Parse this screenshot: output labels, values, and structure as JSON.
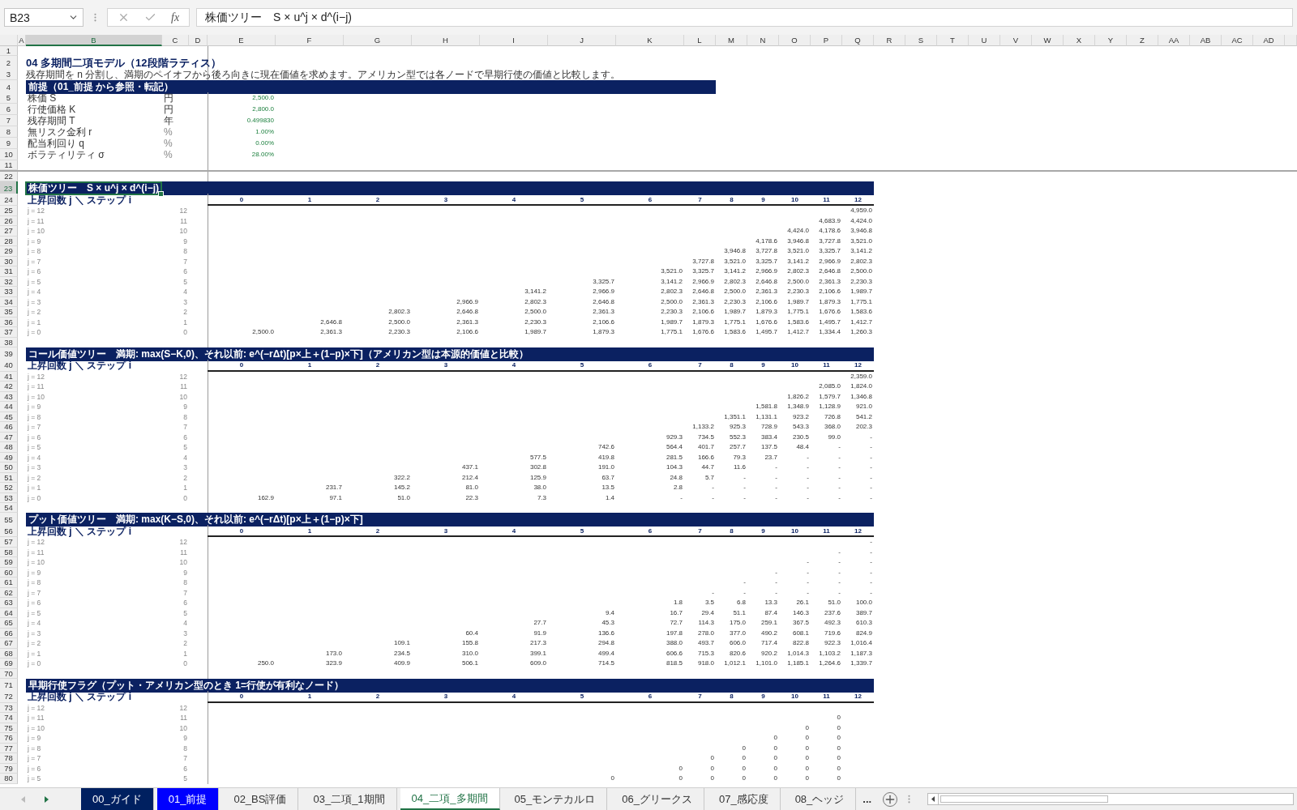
{
  "name_box": "B23",
  "function_label": "fx",
  "formula": "株価ツリー　S × u^j × d^(i−j)",
  "columns": [
    {
      "label": "A",
      "selected": false
    },
    {
      "label": "B",
      "selected": true
    },
    {
      "label": "C",
      "selected": false
    },
    {
      "label": "D",
      "selected": false
    },
    {
      "label": "E",
      "selected": false
    },
    {
      "label": "F",
      "selected": false
    },
    {
      "label": "G",
      "selected": false
    },
    {
      "label": "H",
      "selected": false
    },
    {
      "label": "I",
      "selected": false
    },
    {
      "label": "J",
      "selected": false
    },
    {
      "label": "K",
      "selected": false
    },
    {
      "label": "L",
      "selected": false
    },
    {
      "label": "M",
      "selected": false
    },
    {
      "label": "N",
      "selected": false
    },
    {
      "label": "O",
      "selected": false
    },
    {
      "label": "P",
      "selected": false
    },
    {
      "label": "Q",
      "selected": false
    },
    {
      "label": "R",
      "selected": false
    },
    {
      "label": "S",
      "selected": false
    },
    {
      "label": "T",
      "selected": false
    },
    {
      "label": "U",
      "selected": false
    },
    {
      "label": "V",
      "selected": false
    },
    {
      "label": "W",
      "selected": false
    },
    {
      "label": "X",
      "selected": false
    },
    {
      "label": "Y",
      "selected": false
    },
    {
      "label": "Z",
      "selected": false
    },
    {
      "label": "AA",
      "selected": false
    },
    {
      "label": "AB",
      "selected": false
    },
    {
      "label": "AC",
      "selected": false
    },
    {
      "label": "AD",
      "selected": false
    }
  ],
  "rows": [
    {
      "number": "1",
      "selected": false,
      "kind": "blank"
    },
    {
      "number": "2",
      "selected": false,
      "kind": "title",
      "text": "04 多期間二項モデル（12段階ラティス）"
    },
    {
      "number": "3",
      "selected": false,
      "kind": "note",
      "text": "残存期間を n 分割し、満期のペイオフから後ろ向きに現在価値を求めます。アメリカン型では各ノードで早期行使の価値と比較します。"
    },
    {
      "number": "4",
      "selected": false,
      "kind": "band",
      "wide": false,
      "text": "前提（01_前提 から参照・転記）"
    },
    {
      "number": "5",
      "selected": false,
      "kind": "param",
      "label": "株価 S",
      "unit": "円",
      "value": "2,500.0"
    },
    {
      "number": "6",
      "selected": false,
      "kind": "param",
      "label": "行使価格 K",
      "unit": "円",
      "value": "2,800.0"
    },
    {
      "number": "7",
      "selected": false,
      "kind": "param",
      "label": "残存期間 T",
      "unit": "年",
      "value": "0.499830"
    },
    {
      "number": "8",
      "selected": false,
      "kind": "param",
      "label": "無リスク金利 r",
      "unit": "%",
      "value": "1.00%"
    },
    {
      "number": "9",
      "selected": false,
      "kind": "param",
      "label": "配当利回り q",
      "unit": "%",
      "value": "0.00%"
    },
    {
      "number": "10",
      "selected": false,
      "kind": "param",
      "label": "ボラティリティ σ",
      "unit": "%",
      "value": "28.00%"
    },
    {
      "number": "11",
      "selected": false,
      "kind": "blank"
    },
    {
      "number": "22",
      "selected": false,
      "kind": "blank",
      "hidden_before": true
    },
    {
      "number": "23",
      "selected": true,
      "kind": "band",
      "wide": true,
      "text": "株価ツリー　S × u^j × d^(i−j)"
    },
    {
      "number": "24",
      "selected": false,
      "kind": "steps",
      "label": "上昇回数 j ＼ ステップ i",
      "steps": [
        "0",
        "1",
        "2",
        "3",
        "4",
        "5",
        "6",
        "7",
        "8",
        "9",
        "10",
        "11",
        "12"
      ]
    },
    {
      "number": "25",
      "selected": false,
      "kind": "node",
      "label": "j = 12",
      "count": "12",
      "cells": [
        null,
        null,
        null,
        null,
        null,
        null,
        null,
        null,
        null,
        null,
        null,
        null,
        "4,959.0"
      ]
    },
    {
      "number": "26",
      "selected": false,
      "kind": "node",
      "label": "j = 11",
      "count": "11",
      "cells": [
        null,
        null,
        null,
        null,
        null,
        null,
        null,
        null,
        null,
        null,
        null,
        "4,683.9",
        "4,424.0"
      ]
    },
    {
      "number": "27",
      "selected": false,
      "kind": "node",
      "label": "j = 10",
      "count": "10",
      "cells": [
        null,
        null,
        null,
        null,
        null,
        null,
        null,
        null,
        null,
        null,
        "4,424.0",
        "4,178.6",
        "3,946.8"
      ]
    },
    {
      "number": "28",
      "selected": false,
      "kind": "node",
      "label": "j = 9",
      "count": "9",
      "cells": [
        null,
        null,
        null,
        null,
        null,
        null,
        null,
        null,
        null,
        "4,178.6",
        "3,946.8",
        "3,727.8",
        "3,521.0"
      ]
    },
    {
      "number": "29",
      "selected": false,
      "kind": "node",
      "label": "j = 8",
      "count": "8",
      "cells": [
        null,
        null,
        null,
        null,
        null,
        null,
        null,
        null,
        "3,946.8",
        "3,727.8",
        "3,521.0",
        "3,325.7",
        "3,141.2"
      ]
    },
    {
      "number": "30",
      "selected": false,
      "kind": "node",
      "label": "j = 7",
      "count": "7",
      "cells": [
        null,
        null,
        null,
        null,
        null,
        null,
        null,
        "3,727.8",
        "3,521.0",
        "3,325.7",
        "3,141.2",
        "2,966.9",
        "2,802.3"
      ]
    },
    {
      "number": "31",
      "selected": false,
      "kind": "node",
      "label": "j = 6",
      "count": "6",
      "cells": [
        null,
        null,
        null,
        null,
        null,
        null,
        "3,521.0",
        "3,325.7",
        "3,141.2",
        "2,966.9",
        "2,802.3",
        "2,646.8",
        "2,500.0"
      ]
    },
    {
      "number": "32",
      "selected": false,
      "kind": "node",
      "label": "j = 5",
      "count": "5",
      "cells": [
        null,
        null,
        null,
        null,
        null,
        "3,325.7",
        "3,141.2",
        "2,966.9",
        "2,802.3",
        "2,646.8",
        "2,500.0",
        "2,361.3",
        "2,230.3"
      ]
    },
    {
      "number": "33",
      "selected": false,
      "kind": "node",
      "label": "j = 4",
      "count": "4",
      "cells": [
        null,
        null,
        null,
        null,
        "3,141.2",
        "2,966.9",
        "2,802.3",
        "2,646.8",
        "2,500.0",
        "2,361.3",
        "2,230.3",
        "2,106.6",
        "1,989.7"
      ]
    },
    {
      "number": "34",
      "selected": false,
      "kind": "node",
      "label": "j = 3",
      "count": "3",
      "cells": [
        null,
        null,
        null,
        "2,966.9",
        "2,802.3",
        "2,646.8",
        "2,500.0",
        "2,361.3",
        "2,230.3",
        "2,106.6",
        "1,989.7",
        "1,879.3",
        "1,775.1"
      ]
    },
    {
      "number": "35",
      "selected": false,
      "kind": "node",
      "label": "j = 2",
      "count": "2",
      "cells": [
        null,
        null,
        "2,802.3",
        "2,646.8",
        "2,500.0",
        "2,361.3",
        "2,230.3",
        "2,106.6",
        "1,989.7",
        "1,879.3",
        "1,775.1",
        "1,676.6",
        "1,583.6"
      ]
    },
    {
      "number": "36",
      "selected": false,
      "kind": "node",
      "label": "j = 1",
      "count": "1",
      "cells": [
        null,
        "2,646.8",
        "2,500.0",
        "2,361.3",
        "2,230.3",
        "2,106.6",
        "1,989.7",
        "1,879.3",
        "1,775.1",
        "1,676.6",
        "1,583.6",
        "1,495.7",
        "1,412.7"
      ]
    },
    {
      "number": "37",
      "selected": false,
      "kind": "node",
      "label": "j = 0",
      "count": "0",
      "cells": [
        "2,500.0",
        "2,361.3",
        "2,230.3",
        "2,106.6",
        "1,989.7",
        "1,879.3",
        "1,775.1",
        "1,676.6",
        "1,583.6",
        "1,495.7",
        "1,412.7",
        "1,334.4",
        "1,260.3"
      ]
    },
    {
      "number": "38",
      "selected": false,
      "kind": "blank"
    },
    {
      "number": "39",
      "selected": false,
      "kind": "band",
      "wide": true,
      "text": "コール価値ツリー　満期: max(S−K,0)、それ以前: e^(−rΔt)[p×上＋(1−p)×下]（アメリカン型は本源的価値と比較）"
    },
    {
      "number": "40",
      "selected": false,
      "kind": "steps",
      "label": "上昇回数 j ＼ ステップ i",
      "steps": [
        "0",
        "1",
        "2",
        "3",
        "4",
        "5",
        "6",
        "7",
        "8",
        "9",
        "10",
        "11",
        "12"
      ]
    },
    {
      "number": "41",
      "selected": false,
      "kind": "node",
      "label": "j = 12",
      "count": "12",
      "cells": [
        null,
        null,
        null,
        null,
        null,
        null,
        null,
        null,
        null,
        null,
        null,
        null,
        "2,359.0"
      ]
    },
    {
      "number": "42",
      "selected": false,
      "kind": "node",
      "label": "j = 11",
      "count": "11",
      "cells": [
        null,
        null,
        null,
        null,
        null,
        null,
        null,
        null,
        null,
        null,
        null,
        "2,085.0",
        "1,824.0"
      ]
    },
    {
      "number": "43",
      "selected": false,
      "kind": "node",
      "label": "j = 10",
      "count": "10",
      "cells": [
        null,
        null,
        null,
        null,
        null,
        null,
        null,
        null,
        null,
        null,
        "1,826.2",
        "1,579.7",
        "1,346.8"
      ]
    },
    {
      "number": "44",
      "selected": false,
      "kind": "node",
      "label": "j = 9",
      "count": "9",
      "cells": [
        null,
        null,
        null,
        null,
        null,
        null,
        null,
        null,
        null,
        "1,581.8",
        "1,348.9",
        "1,128.9",
        "921.0"
      ]
    },
    {
      "number": "45",
      "selected": false,
      "kind": "node",
      "label": "j = 8",
      "count": "8",
      "cells": [
        null,
        null,
        null,
        null,
        null,
        null,
        null,
        null,
        "1,351.1",
        "1,131.1",
        "923.2",
        "726.8",
        "541.2"
      ]
    },
    {
      "number": "46",
      "selected": false,
      "kind": "node",
      "label": "j = 7",
      "count": "7",
      "cells": [
        null,
        null,
        null,
        null,
        null,
        null,
        null,
        "1,133.2",
        "925.3",
        "728.9",
        "543.3",
        "368.0",
        "202.3"
      ]
    },
    {
      "number": "47",
      "selected": false,
      "kind": "node",
      "label": "j = 6",
      "count": "6",
      "cells": [
        null,
        null,
        null,
        null,
        null,
        null,
        "929.3",
        "734.5",
        "552.3",
        "383.4",
        "230.5",
        "99.0",
        "-"
      ]
    },
    {
      "number": "48",
      "selected": false,
      "kind": "node",
      "label": "j = 5",
      "count": "5",
      "cells": [
        null,
        null,
        null,
        null,
        null,
        "742.6",
        "564.4",
        "401.7",
        "257.7",
        "137.5",
        "48.4",
        "-",
        "-"
      ]
    },
    {
      "number": "49",
      "selected": false,
      "kind": "node",
      "label": "j = 4",
      "count": "4",
      "cells": [
        null,
        null,
        null,
        null,
        "577.5",
        "419.8",
        "281.5",
        "166.6",
        "79.3",
        "23.7",
        "-",
        "-",
        "-"
      ]
    },
    {
      "number": "50",
      "selected": false,
      "kind": "node",
      "label": "j = 3",
      "count": "3",
      "cells": [
        null,
        null,
        null,
        "437.1",
        "302.8",
        "191.0",
        "104.3",
        "44.7",
        "11.6",
        "-",
        "-",
        "-",
        "-"
      ]
    },
    {
      "number": "51",
      "selected": false,
      "kind": "node",
      "label": "j = 2",
      "count": "2",
      "cells": [
        null,
        null,
        "322.2",
        "212.4",
        "125.9",
        "63.7",
        "24.8",
        "5.7",
        "-",
        "-",
        "-",
        "-",
        "-"
      ]
    },
    {
      "number": "52",
      "selected": false,
      "kind": "node",
      "label": "j = 1",
      "count": "1",
      "cells": [
        null,
        "231.7",
        "145.2",
        "81.0",
        "38.0",
        "13.5",
        "2.8",
        "-",
        "-",
        "-",
        "-",
        "-",
        "-"
      ]
    },
    {
      "number": "53",
      "selected": false,
      "kind": "node",
      "label": "j = 0",
      "count": "0",
      "cells": [
        "162.9",
        "97.1",
        "51.0",
        "22.3",
        "7.3",
        "1.4",
        "-",
        "-",
        "-",
        "-",
        "-",
        "-",
        "-"
      ]
    },
    {
      "number": "54",
      "selected": false,
      "kind": "blank"
    },
    {
      "number": "55",
      "selected": false,
      "kind": "band",
      "wide": true,
      "text": "プット価値ツリー　満期: max(K−S,0)、それ以前: e^(−rΔt)[p×上＋(1−p)×下]"
    },
    {
      "number": "56",
      "selected": false,
      "kind": "steps",
      "label": "上昇回数 j ＼ ステップ i",
      "steps": [
        "0",
        "1",
        "2",
        "3",
        "4",
        "5",
        "6",
        "7",
        "8",
        "9",
        "10",
        "11",
        "12"
      ]
    },
    {
      "number": "57",
      "selected": false,
      "kind": "node",
      "label": "j = 12",
      "count": "12",
      "cells": [
        null,
        null,
        null,
        null,
        null,
        null,
        null,
        null,
        null,
        null,
        null,
        null,
        "-"
      ]
    },
    {
      "number": "58",
      "selected": false,
      "kind": "node",
      "label": "j = 11",
      "count": "11",
      "cells": [
        null,
        null,
        null,
        null,
        null,
        null,
        null,
        null,
        null,
        null,
        null,
        "-",
        "-"
      ]
    },
    {
      "number": "59",
      "selected": false,
      "kind": "node",
      "label": "j = 10",
      "count": "10",
      "cells": [
        null,
        null,
        null,
        null,
        null,
        null,
        null,
        null,
        null,
        null,
        "-",
        "-",
        "-"
      ]
    },
    {
      "number": "60",
      "selected": false,
      "kind": "node",
      "label": "j = 9",
      "count": "9",
      "cells": [
        null,
        null,
        null,
        null,
        null,
        null,
        null,
        null,
        null,
        "-",
        "-",
        "-",
        "-"
      ]
    },
    {
      "number": "61",
      "selected": false,
      "kind": "node",
      "label": "j = 8",
      "count": "8",
      "cells": [
        null,
        null,
        null,
        null,
        null,
        null,
        null,
        null,
        "-",
        "-",
        "-",
        "-",
        "-"
      ]
    },
    {
      "number": "62",
      "selected": false,
      "kind": "node",
      "label": "j = 7",
      "count": "7",
      "cells": [
        null,
        null,
        null,
        null,
        null,
        null,
        null,
        "-",
        "-",
        "-",
        "-",
        "-",
        "-"
      ]
    },
    {
      "number": "63",
      "selected": false,
      "kind": "node",
      "label": "j = 6",
      "count": "6",
      "cells": [
        null,
        null,
        null,
        null,
        null,
        null,
        "1.8",
        "3.5",
        "6.8",
        "13.3",
        "26.1",
        "51.0",
        "100.0"
      ]
    },
    {
      "number": "64",
      "selected": false,
      "kind": "node",
      "label": "j = 5",
      "count": "5",
      "cells": [
        null,
        null,
        null,
        null,
        null,
        "9.4",
        "16.7",
        "29.4",
        "51.1",
        "87.4",
        "146.3",
        "237.6",
        "389.7"
      ]
    },
    {
      "number": "65",
      "selected": false,
      "kind": "node",
      "label": "j = 4",
      "count": "4",
      "cells": [
        null,
        null,
        null,
        null,
        "27.7",
        "45.3",
        "72.7",
        "114.3",
        "175.0",
        "259.1",
        "367.5",
        "492.3",
        "610.3"
      ]
    },
    {
      "number": "66",
      "selected": false,
      "kind": "node",
      "label": "j = 3",
      "count": "3",
      "cells": [
        null,
        null,
        null,
        "60.4",
        "91.9",
        "136.6",
        "197.8",
        "278.0",
        "377.0",
        "490.2",
        "608.1",
        "719.6",
        "824.9"
      ]
    },
    {
      "number": "67",
      "selected": false,
      "kind": "node",
      "label": "j = 2",
      "count": "2",
      "cells": [
        null,
        null,
        "109.1",
        "155.8",
        "217.3",
        "294.8",
        "388.0",
        "493.7",
        "606.0",
        "717.4",
        "822.8",
        "922.3",
        "1,016.4"
      ]
    },
    {
      "number": "68",
      "selected": false,
      "kind": "node",
      "label": "j = 1",
      "count": "1",
      "cells": [
        null,
        "173.0",
        "234.5",
        "310.0",
        "399.1",
        "499.4",
        "606.6",
        "715.3",
        "820.6",
        "920.2",
        "1,014.3",
        "1,103.2",
        "1,187.3"
      ]
    },
    {
      "number": "69",
      "selected": false,
      "kind": "node",
      "label": "j = 0",
      "count": "0",
      "cells": [
        "250.0",
        "323.9",
        "409.9",
        "506.1",
        "609.0",
        "714.5",
        "818.5",
        "918.0",
        "1,012.1",
        "1,101.0",
        "1,185.1",
        "1,264.6",
        "1,339.7"
      ]
    },
    {
      "number": "70",
      "selected": false,
      "kind": "blank"
    },
    {
      "number": "71",
      "selected": false,
      "kind": "band",
      "wide": true,
      "text": "早期行使フラグ（プット・アメリカン型のとき 1=行使が有利なノード）"
    },
    {
      "number": "72",
      "selected": false,
      "kind": "steps",
      "label": "上昇回数 j ＼ ステップ i",
      "steps": [
        "0",
        "1",
        "2",
        "3",
        "4",
        "5",
        "6",
        "7",
        "8",
        "9",
        "10",
        "11",
        "12"
      ]
    },
    {
      "number": "73",
      "selected": false,
      "kind": "node",
      "label": "j = 12",
      "count": "12",
      "cells": [
        null,
        null,
        null,
        null,
        null,
        null,
        null,
        null,
        null,
        null,
        null,
        null,
        null
      ]
    },
    {
      "number": "74",
      "selected": false,
      "kind": "node",
      "label": "j = 11",
      "count": "11",
      "cells": [
        null,
        null,
        null,
        null,
        null,
        null,
        null,
        null,
        null,
        null,
        null,
        "0",
        null
      ]
    },
    {
      "number": "75",
      "selected": false,
      "kind": "node",
      "label": "j = 10",
      "count": "10",
      "cells": [
        null,
        null,
        null,
        null,
        null,
        null,
        null,
        null,
        null,
        null,
        "0",
        "0",
        null
      ]
    },
    {
      "number": "76",
      "selected": false,
      "kind": "node",
      "label": "j = 9",
      "count": "9",
      "cells": [
        null,
        null,
        null,
        null,
        null,
        null,
        null,
        null,
        null,
        "0",
        "0",
        "0",
        null
      ]
    },
    {
      "number": "77",
      "selected": false,
      "kind": "node",
      "label": "j = 8",
      "count": "8",
      "cells": [
        null,
        null,
        null,
        null,
        null,
        null,
        null,
        null,
        "0",
        "0",
        "0",
        "0",
        null
      ]
    },
    {
      "number": "78",
      "selected": false,
      "kind": "node",
      "label": "j = 7",
      "count": "7",
      "cells": [
        null,
        null,
        null,
        null,
        null,
        null,
        null,
        "0",
        "0",
        "0",
        "0",
        "0",
        null
      ]
    },
    {
      "number": "79",
      "selected": false,
      "kind": "node",
      "label": "j = 6",
      "count": "6",
      "cells": [
        null,
        null,
        null,
        null,
        null,
        null,
        "0",
        "0",
        "0",
        "0",
        "0",
        "0",
        null
      ]
    },
    {
      "number": "80",
      "selected": false,
      "kind": "node",
      "label": "j = 5",
      "count": "5",
      "cells": [
        null,
        null,
        null,
        null,
        null,
        "0",
        "0",
        "0",
        "0",
        "0",
        "0",
        "0",
        null
      ]
    }
  ],
  "tabs": [
    {
      "label": "00_ガイド",
      "selected": false,
      "color": "#002060"
    },
    {
      "label": "01_前提",
      "selected": false,
      "color": "#0000ff"
    },
    {
      "label": "02_BS評価",
      "selected": false
    },
    {
      "label": "03_二項_1期間",
      "selected": false
    },
    {
      "label": "04_二項_多期間",
      "selected": true
    },
    {
      "label": "05_モンテカルロ",
      "selected": false
    },
    {
      "label": "06_グリークス",
      "selected": false
    },
    {
      "label": "07_感応度",
      "selected": false
    },
    {
      "label": "08_ヘッジ",
      "selected": false
    }
  ],
  "tabs_overflow": "..."
}
